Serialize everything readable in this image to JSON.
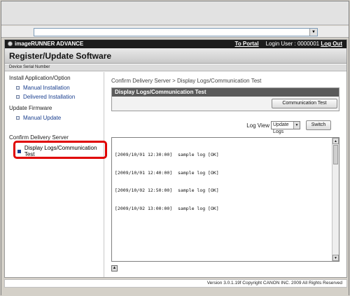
{
  "browser": {
    "address_value": ""
  },
  "topbar": {
    "brand": "imageRUNNER ADVANCE",
    "portal_link": "To Portal",
    "login_user": "Login User : 0000001",
    "logout_link": "Log Out"
  },
  "header": {
    "title": "Register/Update Software"
  },
  "serialbar": {
    "label": "Device Serial Number"
  },
  "sidebar": {
    "sections": [
      {
        "label": "Install Application/Option",
        "items": [
          {
            "label": "Manual Installation"
          },
          {
            "label": "Delivered Installation"
          }
        ]
      },
      {
        "label": "Update Firmware",
        "items": [
          {
            "label": "Manual Update"
          }
        ]
      },
      {
        "label": "Confirm Delivery Server",
        "items": [
          {
            "label": "Display Logs/Communication Test"
          }
        ]
      }
    ]
  },
  "main": {
    "breadcrumb": "Confirm Delivery Server > Display Logs/Communication Test",
    "panel_title": "Display Logs/Communication Test",
    "comm_test_button": "Communication Test",
    "log_view_label": "Log View",
    "log_view_selected": "Update Logs",
    "switch_button": "Switch",
    "log_lines": [
      "[2009/10/01 12:30:00]  sample log [OK]",
      "[2009/10/01 12:40:00]  sample log [OK]",
      "[2009/10/02 12:50:00]  sample log [OK]",
      "[2009/10/02 13:00:00]  sample log [OK]"
    ]
  },
  "footer": {
    "copyright": "Version 3.0.1.19f Copyright CANON INC. 2009 All Rights Reserved"
  },
  "colors": {
    "highlight": "#e00000",
    "link": "#1a3f8f",
    "panel_title_bg": "#5a5a5a"
  }
}
